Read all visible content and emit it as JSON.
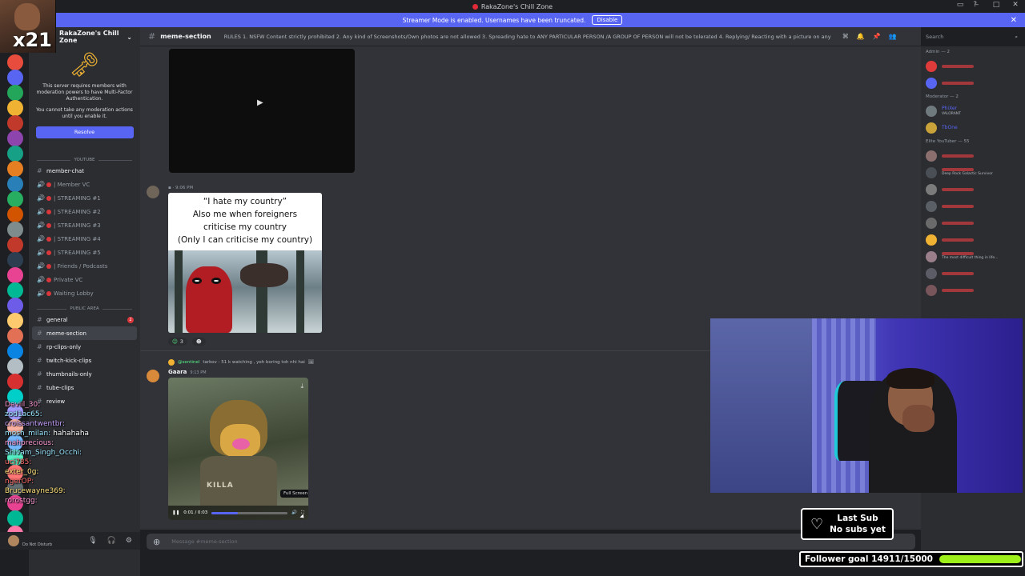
{
  "window": {
    "title": "RakaZone's Chill Zone"
  },
  "banner": {
    "text": "Streamer Mode is enabled. Usernames have been truncated.",
    "disable_label": "Disable",
    "close_icon": "close-icon"
  },
  "overlay_cam": {
    "multiplier": "x21"
  },
  "guild": {
    "name": "RakaZone's Chill Zone"
  },
  "mfa": {
    "message": "This server requires members with moderation powers to have Multi-Factor Authentication.",
    "message2": "You cannot take any moderation actions until you enable it.",
    "resolve_label": "Resolve"
  },
  "sidebar": {
    "category_youtube": "YOUTUBE",
    "category_public": "PUBLIC AREA",
    "youtube_channels": [
      {
        "label": "member-chat",
        "icon": "hash"
      },
      {
        "label": "| Member VC",
        "icon": "speaker"
      },
      {
        "label": "| STREAMING #1",
        "icon": "speaker"
      },
      {
        "label": "| STREAMING #2",
        "icon": "speaker"
      },
      {
        "label": "| STREAMING #3",
        "icon": "speaker"
      },
      {
        "label": "| STREAMING #4",
        "icon": "speaker"
      },
      {
        "label": "| STREAMING #5",
        "icon": "speaker"
      },
      {
        "label": "| Friends / Podcasts",
        "icon": "speaker"
      },
      {
        "label": "Private VC",
        "icon": "speaker"
      },
      {
        "label": "Waiting Lobby",
        "icon": "speaker"
      }
    ],
    "public_channels": [
      {
        "label": "general",
        "mention": "2"
      },
      {
        "label": "meme-section",
        "mention": ""
      },
      {
        "label": "rp-clips-only",
        "mention": ""
      },
      {
        "label": "twitch-kick-clips",
        "mention": ""
      },
      {
        "label": "thumbnails-only",
        "mention": ""
      },
      {
        "label": "tube-clips",
        "mention": ""
      },
      {
        "label": "review",
        "mention": ""
      }
    ]
  },
  "stream_chat": [
    {
      "user": "Deviil_30:",
      "text": "",
      "color": "u1"
    },
    {
      "user": "zod1ac65:",
      "text": "",
      "color": "u2"
    },
    {
      "user": "croissantwentbr:",
      "text": "",
      "color": "u3"
    },
    {
      "user": "mosh_milan:",
      "text": "hahahaha",
      "color": "u2"
    },
    {
      "user": "mahprecious:",
      "text": "",
      "color": "u1"
    },
    {
      "user": "Shivam_Singh_Occhi:",
      "text": "",
      "color": "u2"
    },
    {
      "user": "uci785:",
      "text": "",
      "color": "u4"
    },
    {
      "user": "exter_0g:",
      "text": "",
      "color": "u5"
    },
    {
      "user": "ngerOP:",
      "text": "",
      "color": "u4"
    },
    {
      "user": "Brucewayne369:",
      "text": "",
      "color": "u5"
    },
    {
      "user": "rorostgg:",
      "text": "",
      "color": "u1"
    }
  ],
  "userpanel": {
    "status": "Do Not Disturb"
  },
  "channel": {
    "name": "meme-section",
    "topic": "RULES 1. NSFW Content strictly prohibited 2. Any kind of Screenshots/Own photos are not allowed 3. Spreading hate to ANY PARTICULAR PERSON /A GROUP OF PERSON will not be tolerated 4. Replying/ Reacting with a picture on any Meme is not allowed. 5. Meme..."
  },
  "search": {
    "placeholder": "Search"
  },
  "messages": {
    "msg1_time": "9:06 PM",
    "meme_caption": [
      "“I hate my country”",
      "Also me when foreigners",
      "criticise my country",
      "(Only I can criticise my country)"
    ],
    "reaction_count": "3",
    "reply_user": "@sentinel",
    "reply_text": "tarkov - 51 k watching , yeh boring toh nhi hai",
    "author": "Gaara",
    "author_time": "9:13 PM",
    "video_label": "KILLA",
    "fullscreen_tip": "Full Screen",
    "video_time": "0:01 / 0:03",
    "video_progress": 0.34
  },
  "composer": {
    "placeholder": "Message #meme-section"
  },
  "members": {
    "groups": [
      {
        "title": "Admin — 2",
        "items": [
          {
            "name": "",
            "color": "#f23f43",
            "sub": "",
            "av": "#e03b3b"
          },
          {
            "name": "",
            "color": "#f23f43",
            "sub": "",
            "av": "#5865f2"
          }
        ]
      },
      {
        "title": "Moderator — 2",
        "items": [
          {
            "name": "PhiXer",
            "color": "#5865f2",
            "sub": "VALORANT",
            "av": "#6f7a7f"
          },
          {
            "name": "TbOne",
            "color": "#5865f2",
            "sub": "",
            "av": "#c9a33a"
          }
        ]
      },
      {
        "title": "Elite YouTuber — 55",
        "items": [
          {
            "name": "",
            "color": "#f23f43",
            "sub": "",
            "av": "#8b6f6f"
          },
          {
            "name": "",
            "color": "#f23f43",
            "sub": "Deep Rock Galactic Survivor",
            "av": "#4a4f55"
          },
          {
            "name": "",
            "color": "#f23f43",
            "sub": "",
            "av": "#7b7b7b"
          },
          {
            "name": "",
            "color": "#f23f43",
            "sub": "",
            "av": "#5a5f66"
          },
          {
            "name": "",
            "color": "#f23f43",
            "sub": "",
            "av": "#6a6a6a"
          },
          {
            "name": "",
            "color": "#f23f43",
            "sub": "",
            "av": "#f0b232"
          },
          {
            "name": "",
            "color": "#f23f43",
            "sub": "The most difficult thing in life...",
            "av": "#9a7f8a"
          },
          {
            "name": "",
            "color": "#f23f43",
            "sub": "",
            "av": "#5c5c66"
          },
          {
            "name": "",
            "color": "#f23f43",
            "sub": "",
            "av": "#77555a"
          }
        ]
      }
    ]
  },
  "widgets": {
    "last_sub_title": "Last Sub",
    "last_sub_value": "No subs yet",
    "follower_goal": "Follower goal 14911/15000",
    "follower_fraction": 0.994
  }
}
